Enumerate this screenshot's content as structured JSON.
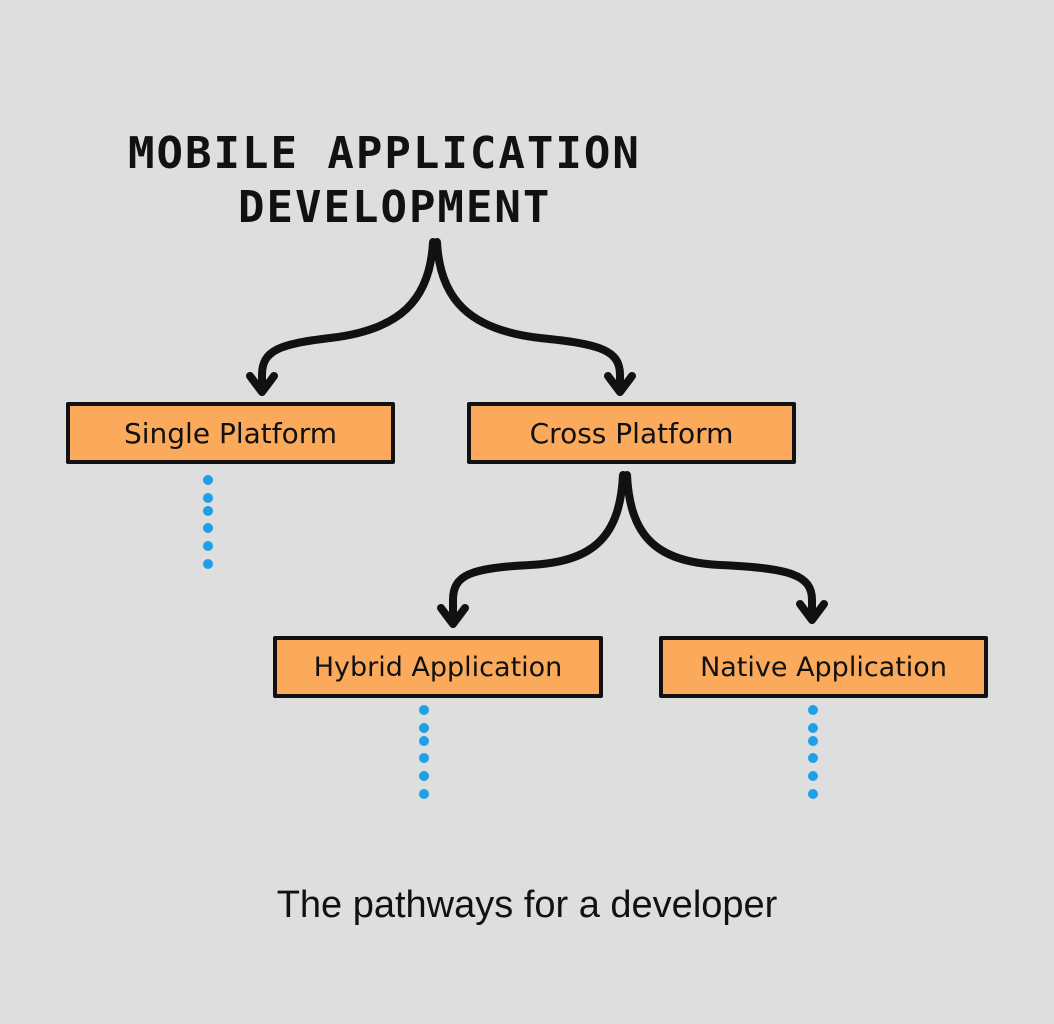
{
  "title": {
    "line1": "MOBILE APPLICATION",
    "line2": "DEVELOPMENT"
  },
  "nodes": {
    "single_platform": "Single Platform",
    "cross_platform": "Cross Platform",
    "hybrid_application": "Hybrid Application",
    "native_application": "Native Application"
  },
  "edges": [
    {
      "from": "title",
      "to": "single_platform"
    },
    {
      "from": "title",
      "to": "cross_platform"
    },
    {
      "from": "cross_platform",
      "to": "hybrid_application"
    },
    {
      "from": "cross_platform",
      "to": "native_application"
    }
  ],
  "continuations": [
    "single_platform",
    "hybrid_application",
    "native_application"
  ],
  "caption": "The pathways for a developer",
  "colors": {
    "background": "#dedede",
    "node_fill": "#fbaa5c",
    "node_border": "#111111",
    "arrow": "#111111",
    "dots": "#1ea0e6"
  }
}
